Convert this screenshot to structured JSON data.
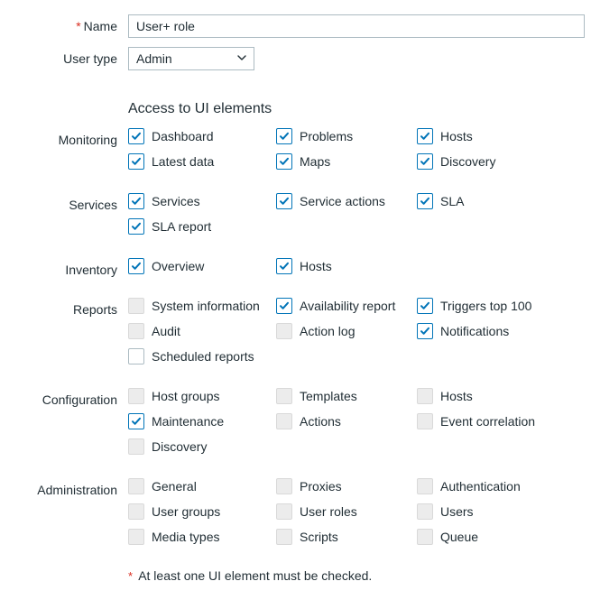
{
  "form": {
    "name_label": "Name",
    "name_value": "User+ role",
    "user_type_label": "User type",
    "user_type_value": "Admin",
    "section_heading": "Access to UI elements",
    "note_text": "At least one UI element must be checked."
  },
  "groups": {
    "monitoring": {
      "label": "Monitoring",
      "items": [
        {
          "label": "Dashboard",
          "state": "checked"
        },
        {
          "label": "Problems",
          "state": "checked"
        },
        {
          "label": "Hosts",
          "state": "checked"
        },
        {
          "label": "Latest data",
          "state": "checked"
        },
        {
          "label": "Maps",
          "state": "checked"
        },
        {
          "label": "Discovery",
          "state": "checked"
        }
      ]
    },
    "services": {
      "label": "Services",
      "items": [
        {
          "label": "Services",
          "state": "checked"
        },
        {
          "label": "Service actions",
          "state": "checked"
        },
        {
          "label": "SLA",
          "state": "checked"
        },
        {
          "label": "SLA report",
          "state": "checked"
        }
      ]
    },
    "inventory": {
      "label": "Inventory",
      "items": [
        {
          "label": "Overview",
          "state": "checked"
        },
        {
          "label": "Hosts",
          "state": "checked"
        }
      ]
    },
    "reports": {
      "label": "Reports",
      "items": [
        {
          "label": "System information",
          "state": "disabled"
        },
        {
          "label": "Availability report",
          "state": "checked"
        },
        {
          "label": "Triggers top 100",
          "state": "checked"
        },
        {
          "label": "Audit",
          "state": "disabled"
        },
        {
          "label": "Action log",
          "state": "disabled"
        },
        {
          "label": "Notifications",
          "state": "checked"
        },
        {
          "label": "Scheduled reports",
          "state": "unchecked"
        }
      ]
    },
    "configuration": {
      "label": "Configuration",
      "items": [
        {
          "label": "Host groups",
          "state": "disabled"
        },
        {
          "label": "Templates",
          "state": "disabled"
        },
        {
          "label": "Hosts",
          "state": "disabled"
        },
        {
          "label": "Maintenance",
          "state": "checked"
        },
        {
          "label": "Actions",
          "state": "disabled"
        },
        {
          "label": "Event correlation",
          "state": "disabled"
        },
        {
          "label": "Discovery",
          "state": "disabled"
        }
      ]
    },
    "administration": {
      "label": "Administration",
      "items": [
        {
          "label": "General",
          "state": "disabled"
        },
        {
          "label": "Proxies",
          "state": "disabled"
        },
        {
          "label": "Authentication",
          "state": "disabled"
        },
        {
          "label": "User groups",
          "state": "disabled"
        },
        {
          "label": "User roles",
          "state": "disabled"
        },
        {
          "label": "Users",
          "state": "disabled"
        },
        {
          "label": "Media types",
          "state": "disabled"
        },
        {
          "label": "Scripts",
          "state": "disabled"
        },
        {
          "label": "Queue",
          "state": "disabled"
        }
      ]
    }
  },
  "group_order": [
    "monitoring",
    "services",
    "inventory",
    "reports",
    "configuration",
    "administration"
  ]
}
